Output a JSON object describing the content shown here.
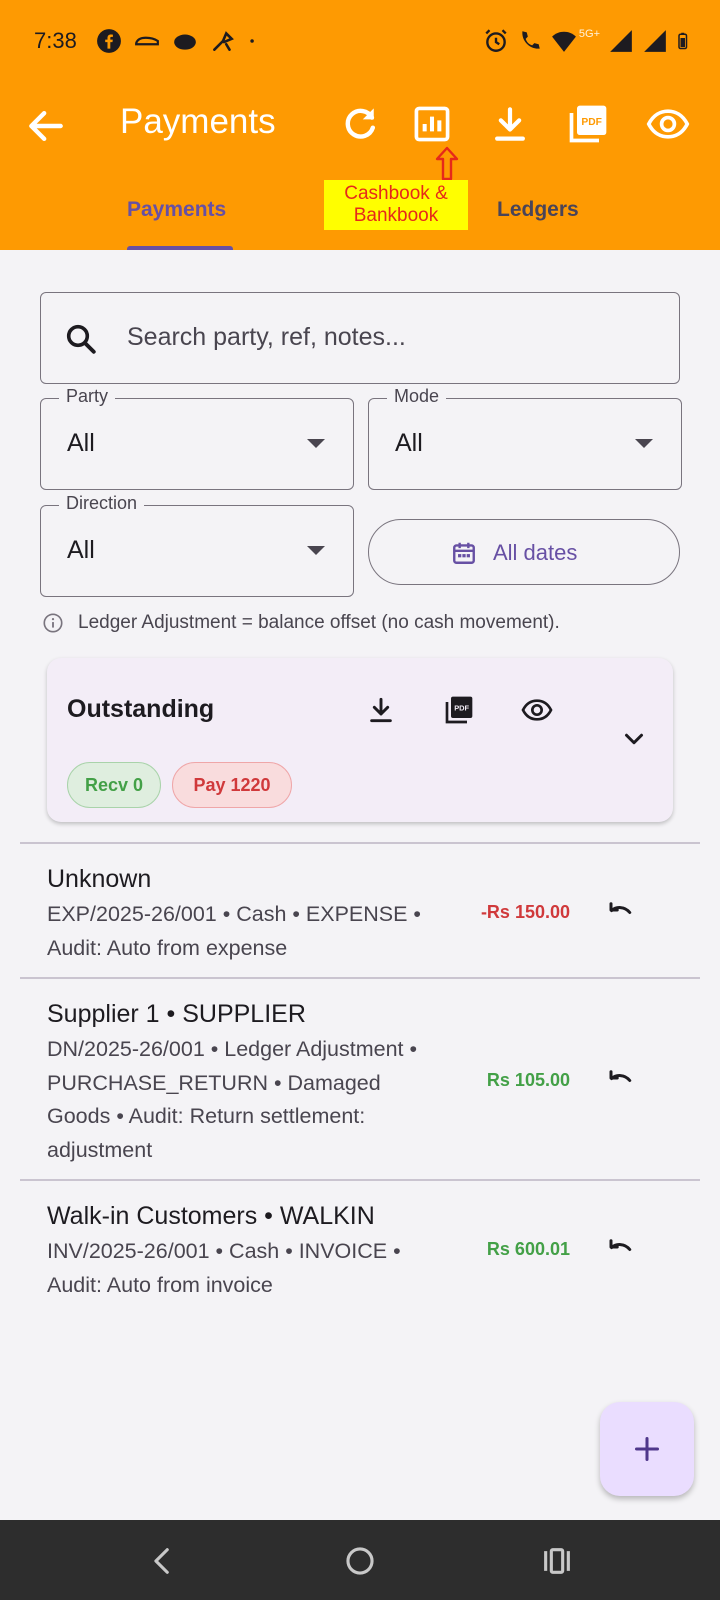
{
  "status_bar": {
    "time": "7:38",
    "left_icons": [
      "facebook-icon",
      "car-icon",
      "cloud-icon",
      "tool-icon",
      "dot-icon"
    ],
    "right_icons": [
      "alarm-icon",
      "wifi-calling-icon",
      "wifi-icon",
      "signal-icon",
      "signal-icon",
      "battery-icon"
    ],
    "network_label": "5G+"
  },
  "toolbar": {
    "title": "Payments",
    "actions": [
      "refresh-icon",
      "report-icon",
      "download-icon",
      "pdf-icon",
      "eye-icon"
    ]
  },
  "annotation": {
    "label": "Cashbook & Bankbook"
  },
  "tabs": [
    {
      "label": "Payments",
      "selected": true
    },
    {
      "label": "Ledgers",
      "selected": false
    }
  ],
  "search": {
    "placeholder": "Search party, ref, notes..."
  },
  "filters": {
    "party": {
      "label": "Party",
      "value": "All"
    },
    "mode": {
      "label": "Mode",
      "value": "All"
    },
    "direction": {
      "label": "Direction",
      "value": "All"
    },
    "dates": {
      "label": "All dates"
    }
  },
  "info_note": "Ledger Adjustment = balance offset (no cash movement).",
  "outstanding": {
    "title": "Outstanding",
    "recv_chip": "Recv 0",
    "pay_chip": "Pay 1220"
  },
  "payments": [
    {
      "title": "Unknown",
      "subtitle": "EXP/2025-26/001 • Cash • EXPENSE • Audit: Auto from expense",
      "amount": "-Rs 150.00",
      "direction": "out"
    },
    {
      "title": "Supplier 1 • SUPPLIER",
      "subtitle": "DN/2025-26/001 • Ledger Adjustment • PURCHASE_RETURN • Damaged Goods • Audit: Return settlement: adjustment",
      "amount": "Rs 105.00",
      "direction": "in"
    },
    {
      "title": "Walk-in Customers • WALKIN",
      "subtitle": "INV/2025-26/001 • Cash • INVOICE • Audit: Auto from invoice",
      "amount": "Rs 600.01",
      "direction": "in"
    }
  ],
  "colors": {
    "appbar": "#fe9a02",
    "accent": "#6750a4",
    "negative": "#d0393b",
    "positive": "#43a047"
  }
}
